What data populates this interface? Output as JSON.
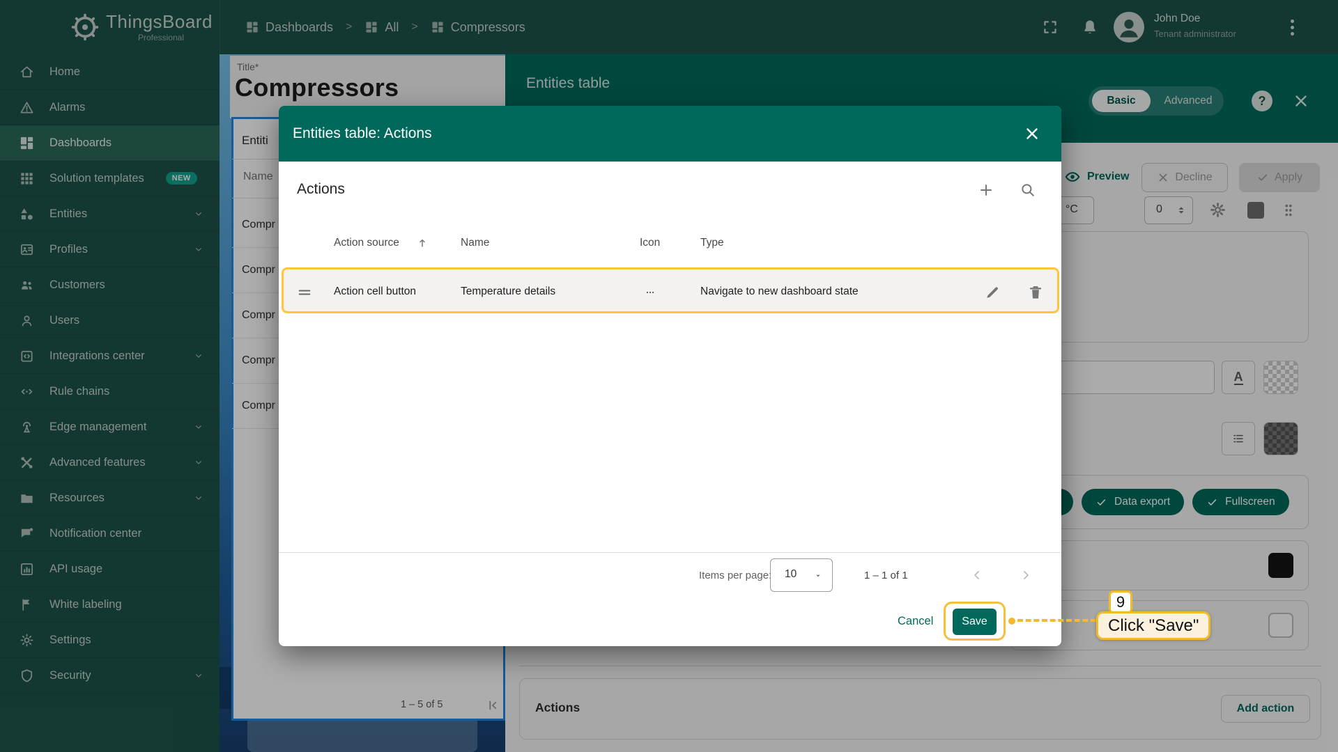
{
  "colors": {
    "primary": "#00695C",
    "sidebar": "#1D5349",
    "amber": "#F2BA2E",
    "row_highlight_border": "#FFC53D",
    "selected_card_border": "#1E88E5"
  },
  "appbar": {
    "brand": "ThingsBoard",
    "brand_sub": "Professional",
    "separator": ">",
    "breadcrumb": [
      {
        "label": "Dashboards",
        "icon": "dashboards"
      },
      {
        "label": "All",
        "icon": "dashboards"
      },
      {
        "label": "Compressors",
        "icon": "dashboards"
      }
    ],
    "user": {
      "name": "John Doe",
      "role": "Tenant administrator"
    }
  },
  "sidebar": {
    "items": [
      {
        "label": "Home",
        "icon": "home"
      },
      {
        "label": "Alarms",
        "icon": "alarm"
      },
      {
        "label": "Dashboards",
        "icon": "dashboards",
        "active": true
      },
      {
        "label": "Solution templates",
        "icon": "solution-templates",
        "badge": "NEW"
      },
      {
        "label": "Entities",
        "icon": "entities",
        "expandable": true
      },
      {
        "label": "Profiles",
        "icon": "profiles",
        "expandable": true
      },
      {
        "label": "Customers",
        "icon": "customers"
      },
      {
        "label": "Users",
        "icon": "users"
      },
      {
        "label": "Integrations center",
        "icon": "integrations",
        "expandable": true
      },
      {
        "label": "Rule chains",
        "icon": "rule-chains"
      },
      {
        "label": "Edge management",
        "icon": "edge",
        "expandable": true
      },
      {
        "label": "Advanced features",
        "icon": "advanced",
        "expandable": true
      },
      {
        "label": "Resources",
        "icon": "resources",
        "expandable": true
      },
      {
        "label": "Notification center",
        "icon": "notification"
      },
      {
        "label": "API usage",
        "icon": "api-usage"
      },
      {
        "label": "White labeling",
        "icon": "white-labeling"
      },
      {
        "label": "Settings",
        "icon": "settings"
      },
      {
        "label": "Security",
        "icon": "security",
        "expandable": true
      }
    ]
  },
  "left_panel": {
    "title_label": "Title*",
    "title_value": "Compressors",
    "tab_label": "Entiti",
    "column_header": "Name",
    "rows": [
      "Compr",
      "Compr",
      "Compr",
      "Compr",
      "Compr"
    ],
    "paginator_range": "1 – 5 of 5"
  },
  "widget_editor": {
    "title": "Entities table",
    "tab_basic": "Basic",
    "tab_advanced": "Advanced",
    "help": "?",
    "preview": "Preview",
    "decline": "Decline",
    "apply": "Apply",
    "unit_value": "°C",
    "count_value": "0",
    "chips": [
      {
        "label": "Data export"
      },
      {
        "label": "Fullscreen"
      }
    ],
    "font_icon_letter": "A",
    "actions_section": "Actions",
    "add_action": "Add action"
  },
  "modal": {
    "title": "Entities table: Actions",
    "section_title": "Actions",
    "columns": [
      "Action source",
      "Name",
      "Icon",
      "Type"
    ],
    "sort_column": "Action source",
    "sort_direction": "asc",
    "row": {
      "action_source": "Action cell button",
      "name": "Temperature details",
      "icon": "more-horiz",
      "type": "Navigate to new dashboard state"
    },
    "paginator": {
      "items_per_page_label": "Items per page:",
      "page_size": "10",
      "range": "1 – 1 of 1"
    },
    "cancel": "Cancel",
    "save": "Save"
  },
  "annotation": {
    "step": "9",
    "label": "Click \"Save\""
  }
}
